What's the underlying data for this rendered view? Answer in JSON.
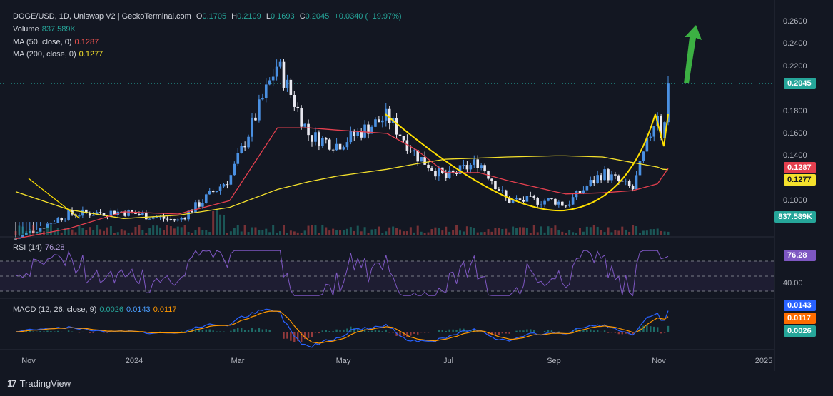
{
  "header": {
    "symbol": "DOGE/USD, 1D, Uniswap V2 | GeckoTerminal.com",
    "o_label": "O",
    "o_value": "0.1705",
    "h_label": "H",
    "h_value": "0.2109",
    "l_label": "L",
    "l_value": "0.1693",
    "c_label": "C",
    "c_value": "0.2045",
    "change": "+0.0340 (+19.97%)"
  },
  "indicators": {
    "volume_label": "Volume",
    "volume_value": "837.589K",
    "ma50_label": "MA (50, close, 0)",
    "ma50_value": "0.1287",
    "ma200_label": "MA (200, close, 0)",
    "ma200_value": "0.1277",
    "rsi_label": "RSI (14)",
    "rsi_value": "76.28",
    "macd_label": "MACD (12, 26, close, 9)",
    "macd_v1": "0.0026",
    "macd_v2": "0.0143",
    "macd_v3": "0.0117"
  },
  "price_tags": {
    "last": "0.2045",
    "ma50": "0.1287",
    "ma200": "0.1277",
    "volume": "837.589K",
    "rsi": "76.28",
    "rsi_level": "40.00",
    "macd_signal": "0.0143",
    "macd_line": "0.0117",
    "macd_hist": "0.0026"
  },
  "colors": {
    "up": "#26a69a",
    "down": "#ef5350",
    "ma50": "#e5404f",
    "ma200": "#f5e12c",
    "rsi": "#7e57c2",
    "macd": "#2962ff",
    "signal": "#ff9800",
    "pattern": "#ffe000",
    "arrow": "#3cb043"
  },
  "x_axis_labels": [
    "Nov",
    "2024",
    "Mar",
    "May",
    "Jul",
    "Sep",
    "Nov",
    "2025"
  ],
  "y_axis_labels": [
    "0.2600",
    "0.2400",
    "0.2200",
    "0.1800",
    "0.1600",
    "0.1400",
    "0.1000"
  ],
  "branding": {
    "logo_text": "17",
    "name": "TradingView"
  },
  "chart_data": {
    "type": "line",
    "title": "DOGE/USD, 1D, Uniswap V2 | GeckoTerminal.com",
    "xlabel": "",
    "ylabel": "",
    "ylim": [
      0.08,
      0.27
    ],
    "x": [
      "2023-11-01",
      "2023-12-01",
      "2024-01-01",
      "2024-02-01",
      "2024-03-01",
      "2024-03-28",
      "2024-04-15",
      "2024-05-01",
      "2024-05-29",
      "2024-06-15",
      "2024-07-01",
      "2024-07-20",
      "2024-08-05",
      "2024-09-01",
      "2024-09-07",
      "2024-09-28",
      "2024-10-15",
      "2024-10-29",
      "2024-11-01",
      "2024-11-04"
    ],
    "series": [
      {
        "name": "DOGE/USD",
        "values": [
          0.066,
          0.088,
          0.09,
          0.082,
          0.12,
          0.222,
          0.158,
          0.15,
          0.175,
          0.14,
          0.12,
          0.135,
          0.1,
          0.1,
          0.096,
          0.125,
          0.11,
          0.18,
          0.15,
          0.2045
        ]
      },
      {
        "name": "MA (50, close, 0)",
        "values": [
          0.066,
          0.075,
          0.09,
          0.088,
          0.1,
          0.165,
          0.165,
          0.163,
          0.16,
          0.145,
          0.125,
          0.125,
          0.118,
          0.108,
          0.106,
          0.107,
          0.109,
          0.115,
          0.122,
          0.1287
        ]
      },
      {
        "name": "MA (200, close, 0)",
        "values": [
          0.108,
          0.092,
          0.084,
          0.087,
          0.094,
          0.11,
          0.117,
          0.122,
          0.128,
          0.133,
          0.137,
          0.138,
          0.139,
          0.14,
          0.14,
          0.139,
          0.134,
          0.13,
          0.128,
          0.1277
        ]
      }
    ],
    "rsi": {
      "name": "RSI (14)",
      "last": 76.28,
      "levels": [
        70,
        50,
        30
      ]
    },
    "macd": {
      "name": "MACD (12, 26, close, 9)",
      "macd": 0.0143,
      "signal": 0.0117,
      "histogram": 0.0026
    },
    "volume": {
      "name": "Volume",
      "last": "837.589K"
    },
    "grid": false,
    "legend": "top-left"
  }
}
